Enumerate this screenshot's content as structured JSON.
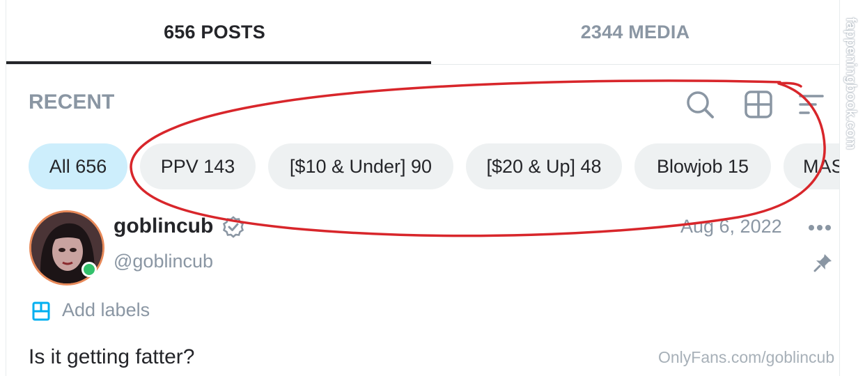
{
  "tabs": [
    {
      "label": "656 POSTS",
      "active": true
    },
    {
      "label": "2344 MEDIA",
      "active": false
    }
  ],
  "feed": {
    "sort_label": "RECENT",
    "icons": [
      "search-icon",
      "grid-icon",
      "sort-icon"
    ]
  },
  "chips": [
    {
      "label": "All 656",
      "active": true
    },
    {
      "label": "PPV 143",
      "active": false
    },
    {
      "label": "[$10 & Under] 90",
      "active": false
    },
    {
      "label": "[$20 & Up] 48",
      "active": false
    },
    {
      "label": "Blowjob 15",
      "active": false
    },
    {
      "label": "MASR",
      "active": false
    }
  ],
  "post": {
    "display_name": "goblincub",
    "handle": "@goblincub",
    "date": "Aug 6, 2022",
    "add_labels": "Add labels",
    "text": "Is it getting fatter?",
    "watermark": "OnlyFans.com/goblincub"
  },
  "side_watermark": "fappeningbook.com",
  "colors": {
    "text_dark": "#242529",
    "text_muted": "#8a96a3",
    "chip_bg": "#eef1f2",
    "chip_active_bg": "#cdeefc",
    "accent_blue": "#00aff0",
    "online_green": "#33c16c",
    "annotation_red": "#d8262b"
  }
}
